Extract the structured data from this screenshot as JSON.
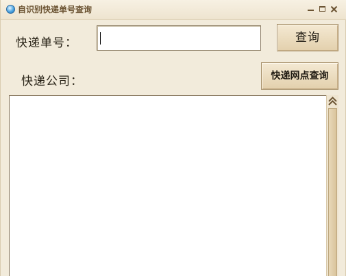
{
  "window": {
    "title": "自识别快递单号查询",
    "controls": {
      "minimize": "minimize",
      "maximize": "maximize",
      "close": "close"
    }
  },
  "form": {
    "tracking_number_label": "快递单号：",
    "tracking_number_value": "",
    "query_button_label": "查询",
    "company_label": "快递公司：",
    "company_value": "",
    "outlet_query_button_label": "快递网点查询"
  },
  "results": {
    "text": ""
  },
  "icons": {
    "app": "globe-icon",
    "close": "close-icon",
    "scroll_up": "double-chevron-up-icon"
  },
  "colors": {
    "background": "#f2ebdb",
    "title_text": "#6b5332",
    "button_face": "#e9dbbd",
    "border": "#8a7b62"
  }
}
